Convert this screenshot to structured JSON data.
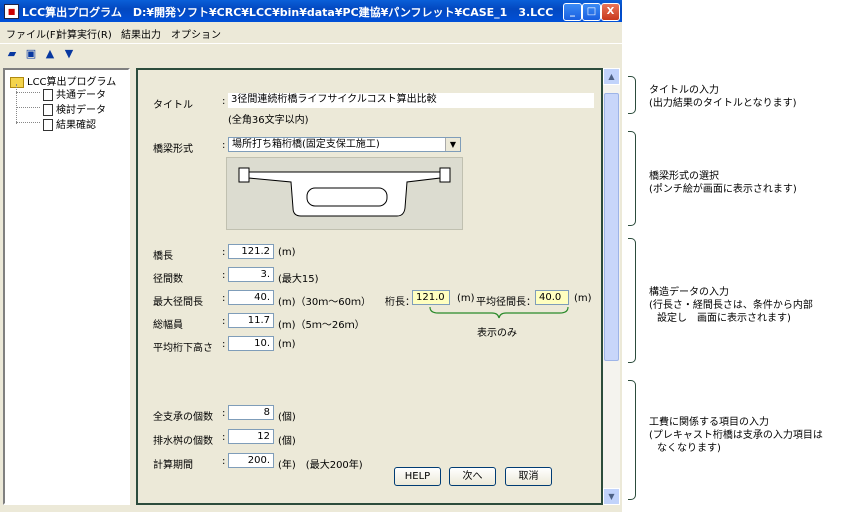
{
  "window": {
    "title": "LCC算出プログラム　D:¥開発ソフト¥CRC¥LCC¥bin¥data¥PC建協¥パンフレット¥CASE_1　3.LCC",
    "minimize": "_",
    "maximize": "□",
    "close": "X"
  },
  "menu": [
    "ファイル(F)",
    "計算実行(R)",
    "結果出力",
    "オプション"
  ],
  "toolbar_icons": [
    "open-icon",
    "save-icon",
    "up-icon",
    "down-icon"
  ],
  "tree": {
    "root": "LCC算出プログラム",
    "children": [
      "共通データ",
      "検討データ",
      "結果確認"
    ]
  },
  "form": {
    "title_label": "タイトル",
    "title_value": "3径間連続桁橋ライフサイクルコスト算出比較",
    "title_hint": "(全角36文字以内)",
    "bridge_type_label": "橋梁形式",
    "bridge_type_value": "場所打ち箱桁橋(固定支保工施工)",
    "bridge_length_label": "橋長",
    "bridge_length_value": "121.2",
    "bridge_length_unit": "(m)",
    "spans_label": "径間数",
    "spans_value": "3.",
    "spans_note": "(最大15)",
    "max_span_label": "最大径間長",
    "max_span_value": "40.",
    "max_span_note": "(m)（30ｍ～60ｍ）",
    "girder_length_label": "桁長：",
    "girder_length_value": "121.0",
    "girder_length_unit": "(m)",
    "avg_span_label": "平均径間長：",
    "avg_span_value": "40.0",
    "avg_span_unit": "(m)",
    "display_only": "表示のみ",
    "width_label": "総幅員",
    "width_value": "11.7",
    "width_note": "(m)（5ｍ～26ｍ）",
    "clearance_label": "平均桁下高さ",
    "clearance_value": "10.",
    "clearance_unit": "(m)",
    "bearings_label": "全支承の個数",
    "bearings_value": "8",
    "bearings_unit": "(個)",
    "drains_label": "排水桝の個数",
    "drains_value": "12",
    "drains_unit": "(個)",
    "period_label": "計算期間",
    "period_value": "200.",
    "period_note": "(年)　(最大200年)",
    "help_button": "HELP",
    "next_button": "次へ",
    "cancel_button": "取消"
  },
  "annotations": {
    "a1": [
      "タイトルの入力",
      "(出力結果のタイトルとなります)"
    ],
    "a2": [
      "橋梁形式の選択",
      "(ポンチ絵が画面に表示されます)"
    ],
    "a3": [
      "構造データの入力",
      "(行長さ・経間長さは、条件から内部",
      "設定し　画面に表示されます)"
    ],
    "a4": [
      "工費に関係する項目の入力",
      "(プレキャスト桁橋は支承の入力項目は",
      "なくなります)"
    ]
  }
}
